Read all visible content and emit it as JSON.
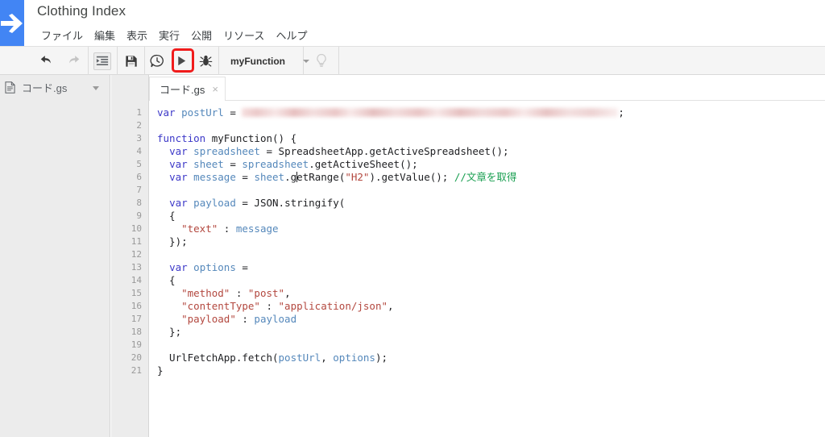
{
  "header": {
    "logo_icon": "apps-script-arrow-icon",
    "doc_title": "Clothing Index",
    "menu": [
      {
        "label": "ファイル"
      },
      {
        "label": "編集"
      },
      {
        "label": "表示"
      },
      {
        "label": "実行"
      },
      {
        "label": "公開"
      },
      {
        "label": "リソース"
      },
      {
        "label": "ヘルプ"
      }
    ]
  },
  "toolbar": {
    "undo_icon": "undo-icon",
    "redo_icon": "redo-icon",
    "indent_icon": "indent-icon",
    "save_icon": "save-icon",
    "history_icon": "history-clock-icon",
    "run_icon": "run-play-icon",
    "debug_icon": "debug-bug-icon",
    "hint_icon": "lightbulb-icon",
    "function_name": "myFunction",
    "run_highlight_color": "#f01c1c"
  },
  "sidebar": {
    "file_icon": "file-script-icon",
    "file_name": "コード.gs",
    "dropdown_icon": "chevron-down-icon"
  },
  "editor": {
    "tab_label": "コード.gs",
    "tab_close_glyph": "×",
    "line_numbers": [
      "1",
      "2",
      "3",
      "4",
      "5",
      "6",
      "7",
      "8",
      "9",
      "10",
      "11",
      "12",
      "13",
      "14",
      "15",
      "16",
      "17",
      "18",
      "19",
      "20",
      "21"
    ],
    "code_lines": [
      {
        "n": 1,
        "tokens": [
          {
            "t": "kw",
            "v": "var"
          },
          {
            "t": "pl",
            "v": " "
          },
          {
            "t": "id",
            "v": "postUrl"
          },
          {
            "t": "pl",
            "v": " = "
          },
          {
            "t": "blur",
            "v": ""
          },
          {
            "t": "pl",
            "v": ";"
          }
        ]
      },
      {
        "n": 2,
        "tokens": []
      },
      {
        "n": 3,
        "tokens": [
          {
            "t": "kw",
            "v": "function"
          },
          {
            "t": "pl",
            "v": " myFunction() {"
          }
        ]
      },
      {
        "n": 4,
        "tokens": [
          {
            "t": "pl",
            "v": "  "
          },
          {
            "t": "kw",
            "v": "var"
          },
          {
            "t": "pl",
            "v": " "
          },
          {
            "t": "id",
            "v": "spreadsheet"
          },
          {
            "t": "pl",
            "v": " = SpreadsheetApp.getActiveSpreadsheet();"
          }
        ]
      },
      {
        "n": 5,
        "tokens": [
          {
            "t": "pl",
            "v": "  "
          },
          {
            "t": "kw",
            "v": "var"
          },
          {
            "t": "pl",
            "v": " "
          },
          {
            "t": "id",
            "v": "sheet"
          },
          {
            "t": "pl",
            "v": " = "
          },
          {
            "t": "id",
            "v": "spreadsheet"
          },
          {
            "t": "pl",
            "v": ".getActiveSheet();"
          }
        ]
      },
      {
        "n": 6,
        "tokens": [
          {
            "t": "pl",
            "v": "  "
          },
          {
            "t": "kw",
            "v": "var"
          },
          {
            "t": "pl",
            "v": " "
          },
          {
            "t": "id",
            "v": "message"
          },
          {
            "t": "pl",
            "v": " = "
          },
          {
            "t": "id",
            "v": "sheet"
          },
          {
            "t": "pl",
            "v": ".g"
          },
          {
            "t": "caret",
            "v": ""
          },
          {
            "t": "pl",
            "v": "etRange("
          },
          {
            "t": "str",
            "v": "\"H2\""
          },
          {
            "t": "pl",
            "v": ").getValue(); "
          },
          {
            "t": "com",
            "v": "//文章を取得"
          }
        ]
      },
      {
        "n": 7,
        "tokens": []
      },
      {
        "n": 8,
        "tokens": [
          {
            "t": "pl",
            "v": "  "
          },
          {
            "t": "kw",
            "v": "var"
          },
          {
            "t": "pl",
            "v": " "
          },
          {
            "t": "id",
            "v": "payload"
          },
          {
            "t": "pl",
            "v": " = JSON.stringify("
          }
        ]
      },
      {
        "n": 9,
        "tokens": [
          {
            "t": "pl",
            "v": "  {"
          }
        ]
      },
      {
        "n": 10,
        "tokens": [
          {
            "t": "pl",
            "v": "    "
          },
          {
            "t": "str",
            "v": "\"text\""
          },
          {
            "t": "pl",
            "v": " : "
          },
          {
            "t": "id",
            "v": "message"
          }
        ]
      },
      {
        "n": 11,
        "tokens": [
          {
            "t": "pl",
            "v": "  });"
          }
        ]
      },
      {
        "n": 12,
        "tokens": []
      },
      {
        "n": 13,
        "tokens": [
          {
            "t": "pl",
            "v": "  "
          },
          {
            "t": "kw",
            "v": "var"
          },
          {
            "t": "pl",
            "v": " "
          },
          {
            "t": "id",
            "v": "options"
          },
          {
            "t": "pl",
            "v": " ="
          }
        ]
      },
      {
        "n": 14,
        "tokens": [
          {
            "t": "pl",
            "v": "  {"
          }
        ]
      },
      {
        "n": 15,
        "tokens": [
          {
            "t": "pl",
            "v": "    "
          },
          {
            "t": "str",
            "v": "\"method\""
          },
          {
            "t": "pl",
            "v": " : "
          },
          {
            "t": "str",
            "v": "\"post\""
          },
          {
            "t": "pl",
            "v": ","
          }
        ]
      },
      {
        "n": 16,
        "tokens": [
          {
            "t": "pl",
            "v": "    "
          },
          {
            "t": "str",
            "v": "\"contentType\""
          },
          {
            "t": "pl",
            "v": " : "
          },
          {
            "t": "str",
            "v": "\"application/json\""
          },
          {
            "t": "pl",
            "v": ","
          }
        ]
      },
      {
        "n": 17,
        "tokens": [
          {
            "t": "pl",
            "v": "    "
          },
          {
            "t": "str",
            "v": "\"payload\""
          },
          {
            "t": "pl",
            "v": " : "
          },
          {
            "t": "id",
            "v": "payload"
          }
        ]
      },
      {
        "n": 18,
        "tokens": [
          {
            "t": "pl",
            "v": "  };"
          }
        ]
      },
      {
        "n": 19,
        "tokens": []
      },
      {
        "n": 20,
        "tokens": [
          {
            "t": "pl",
            "v": "  UrlFetchApp.fetch("
          },
          {
            "t": "id",
            "v": "postUrl"
          },
          {
            "t": "pl",
            "v": ", "
          },
          {
            "t": "id",
            "v": "options"
          },
          {
            "t": "pl",
            "v": ");"
          }
        ]
      },
      {
        "n": 21,
        "tokens": [
          {
            "t": "pl",
            "v": "}"
          }
        ]
      }
    ]
  },
  "colors": {
    "logo_blue": "#4285f4",
    "keyword": "#3c38c8",
    "identifier": "#5588bb",
    "string": "#b3483f",
    "comment": "#179e4f",
    "toolbar_bg": "#f5f5f5",
    "sidebar_bg": "#ececec"
  }
}
